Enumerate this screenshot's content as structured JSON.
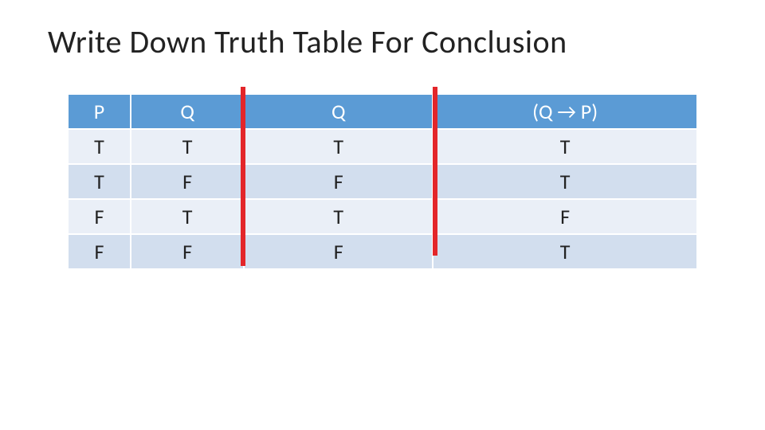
{
  "title": "Write Down Truth Table For Conclusion",
  "chart_data": {
    "type": "table",
    "columns": [
      "P",
      "Q",
      "Q",
      "(Q → P)"
    ],
    "rows": [
      [
        "T",
        "T",
        "T",
        "T"
      ],
      [
        "T",
        "F",
        "F",
        "T"
      ],
      [
        "F",
        "T",
        "T",
        "F"
      ],
      [
        "F",
        "F",
        "F",
        "T"
      ]
    ]
  },
  "annotations": {
    "vertical_lines": {
      "color": "#E3262A",
      "positions": [
        "after column 2",
        "after column 3"
      ]
    }
  }
}
